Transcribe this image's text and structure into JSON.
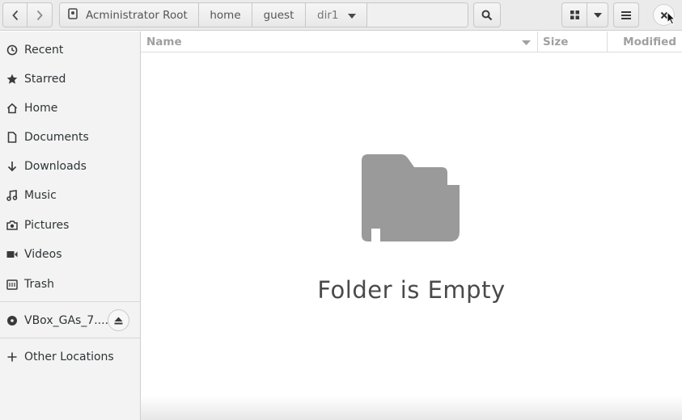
{
  "header": {
    "back_icon": "chevron-left-icon",
    "forward_icon": "chevron-right-icon",
    "path": {
      "root_label": "Acministrator Root",
      "crumbs": [
        "home",
        "guest",
        "dir1"
      ]
    },
    "search_icon": "search-icon",
    "view_icon": "grid-view-icon",
    "view_menu_icon": "triangle-down-icon",
    "menu_icon": "hamburger-menu-icon",
    "close_icon": "close-icon"
  },
  "sidebar": {
    "items": [
      {
        "label": "Recent",
        "icon": "clock-icon"
      },
      {
        "label": "Starred",
        "icon": "star-icon"
      },
      {
        "label": "Home",
        "icon": "home-icon"
      },
      {
        "label": "Documents",
        "icon": "document-icon"
      },
      {
        "label": "Downloads",
        "icon": "download-arrow-icon"
      },
      {
        "label": "Music",
        "icon": "music-note-icon"
      },
      {
        "label": "Pictures",
        "icon": "camera-icon"
      },
      {
        "label": "Videos",
        "icon": "video-icon"
      },
      {
        "label": "Trash",
        "icon": "trash-icon"
      }
    ],
    "device": {
      "label": "VBox_GAs_7....",
      "icon": "disc-icon",
      "eject_icon": "eject-icon"
    },
    "other_locations": {
      "label": "Other Locations",
      "icon": "plus-icon"
    }
  },
  "columns": {
    "name": "Name",
    "size": "Size",
    "modified": "Modified"
  },
  "content": {
    "empty_message": "Folder is Empty",
    "empty_icon": "folder-icon"
  },
  "colors": {
    "folder_gray": "#9a9a9a",
    "sidebar_bg": "#f3f3f3",
    "header_bg": "#ebebeb"
  }
}
